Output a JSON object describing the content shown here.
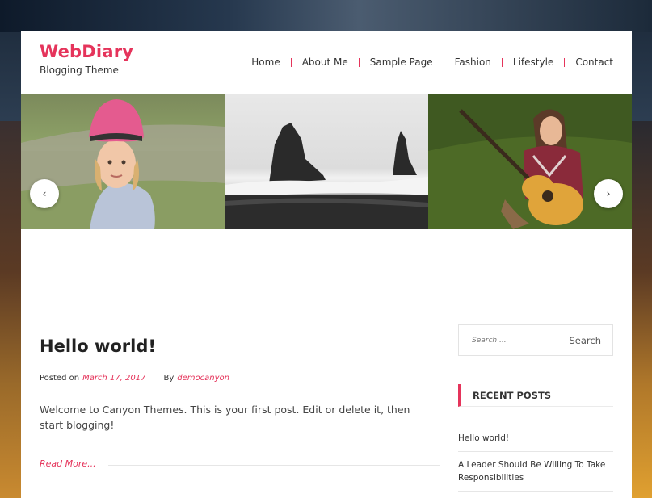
{
  "site": {
    "title": "WebDiary",
    "description": "Blogging Theme",
    "accent_color": "#e5345b"
  },
  "nav": {
    "items": [
      {
        "label": "Home"
      },
      {
        "label": "About Me"
      },
      {
        "label": "Sample Page"
      },
      {
        "label": "Fashion"
      },
      {
        "label": "Lifestyle"
      },
      {
        "label": "Contact"
      }
    ]
  },
  "slider": {
    "prev_label": "‹",
    "next_label": "›",
    "slides": [
      {
        "subject": "child in pink helmet on grass"
      },
      {
        "subject": "sea stacks on black sand beach"
      },
      {
        "subject": "woman playing guitar in grass"
      }
    ]
  },
  "post": {
    "title": "Hello world!",
    "posted_on_label": "Posted on",
    "date": "March 17, 2017",
    "by_label": "By",
    "author": "democanyon",
    "excerpt": "Welcome to Canyon Themes. This is your first post. Edit or delete it, then start blogging!",
    "read_more": "Read More..."
  },
  "sidebar": {
    "search_placeholder": "Search ...",
    "search_button": "Search",
    "recent_posts_title": "RECENT POSTS",
    "recent_posts": [
      {
        "label": "Hello world!"
      },
      {
        "label": "A Leader Should Be Willing To Take Responsibilities"
      }
    ]
  }
}
